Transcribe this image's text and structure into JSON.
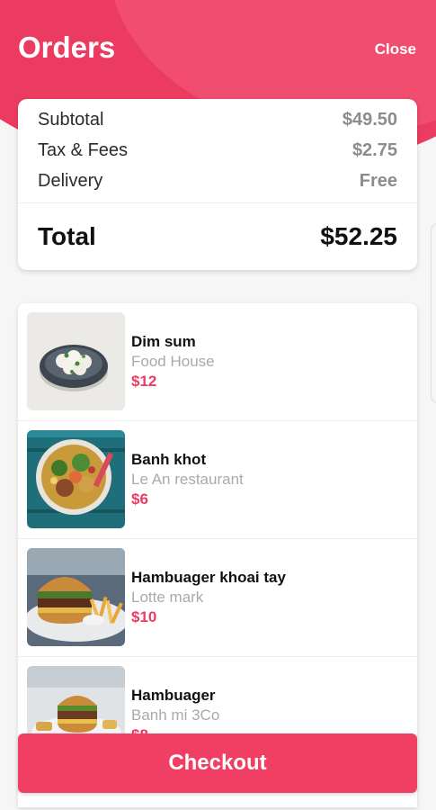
{
  "header": {
    "title": "Orders",
    "close_label": "Close"
  },
  "summary": {
    "subtotal_label": "Subtotal",
    "subtotal_value": "$49.50",
    "tax_label": "Tax & Fees",
    "tax_value": "$2.75",
    "delivery_label": "Delivery",
    "delivery_value": "Free",
    "total_label": "Total",
    "total_value": "$52.25"
  },
  "items": [
    {
      "name": "Dim sum",
      "shop": "Food House",
      "price": "$12"
    },
    {
      "name": "Banh khot",
      "shop": "Le An restaurant",
      "price": "$6"
    },
    {
      "name": "Hambuager khoai tay",
      "shop": "Lotte mark",
      "price": "$10"
    },
    {
      "name": "Hambuager",
      "shop": "Banh mi 3Co",
      "price": "$8"
    }
  ],
  "checkout_label": "Checkout",
  "colors": {
    "accent": "#ec3b61",
    "price": "#ec3b61",
    "button": "#f03f63"
  }
}
